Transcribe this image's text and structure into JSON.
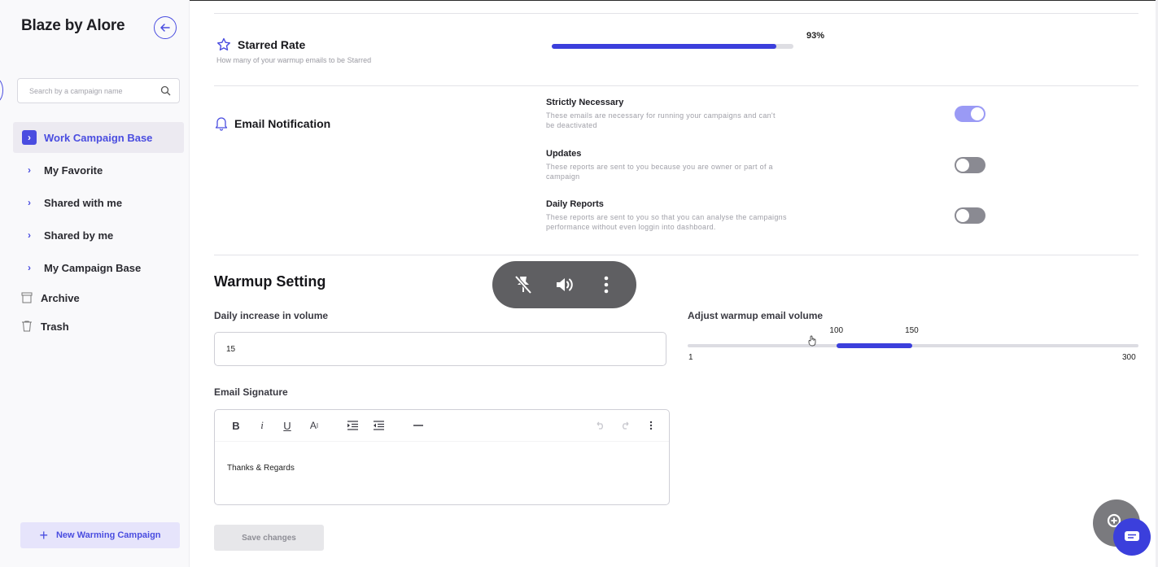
{
  "sidebar": {
    "brand": "Blaze by Alore",
    "search_placeholder": "Search by a campaign name",
    "nav_items": [
      {
        "label": "Work Campaign Base"
      },
      {
        "label": "My Favorite"
      },
      {
        "label": "Shared with me"
      },
      {
        "label": "Shared by me"
      },
      {
        "label": "My Campaign Base"
      }
    ],
    "archive_label": "Archive",
    "trash_label": "Trash",
    "new_campaign_label": "New Warming Campaign"
  },
  "starred": {
    "title": "Starred Rate",
    "subtitle": "How many of your warmup emails to be Starred",
    "percent_label": "93%",
    "progress": 0.93
  },
  "notifications": {
    "title": "Email Notification",
    "items": [
      {
        "title": "Strictly Necessary",
        "desc": "These emails are necessary for running your campaigns and can't be deactivated",
        "on": true
      },
      {
        "title": "Updates",
        "desc": "These reports are sent to you because you are owner or part of a campaign",
        "on": false
      },
      {
        "title": "Daily Reports",
        "desc": "These reports are sent to you so that you can analyse the campaigns performance without even loggin into dashboard.",
        "on": false
      }
    ]
  },
  "warmup": {
    "title": "Warmup Setting",
    "daily_label": "Daily increase in volume",
    "daily_value": "15",
    "volume_label": "Adjust warmup email volume",
    "slider": {
      "min": 1,
      "max": 300,
      "low": 100,
      "high": 150,
      "min_label": "1",
      "max_label": "300",
      "low_label": "100",
      "high_label": "150"
    },
    "signature_label": "Email Signature",
    "signature_text": "Thanks & Regards",
    "save_label": "Save changes"
  },
  "toolbar_icons": [
    "bold-icon",
    "italic-icon",
    "underline-icon",
    "text-size-icon",
    "indent-icon",
    "outdent-icon",
    "horizontal-rule-icon",
    "undo-icon",
    "redo-icon",
    "more-icon"
  ],
  "colors": {
    "accent": "#3b3fdc",
    "toggle_on": "#9a9af5",
    "toggle_off": "#8a8a92"
  }
}
